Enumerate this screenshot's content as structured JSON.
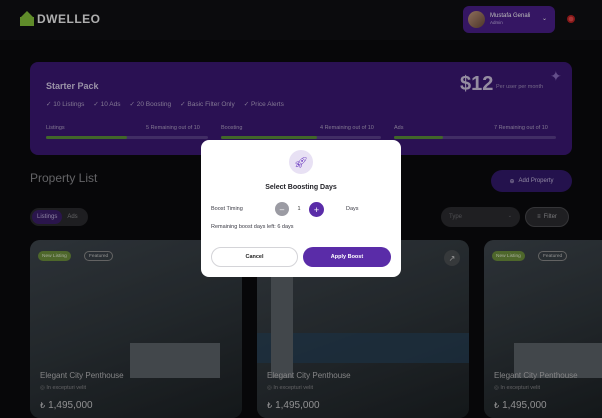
{
  "header": {
    "logo_text": "DWELLEO",
    "user_name": "Mustafa Genali",
    "user_role": "Admin"
  },
  "starter_pack": {
    "title": "Starter Pack",
    "features": [
      "10 Listings",
      "10 Ads",
      "20 Boosting",
      "Basic Filter Only",
      "Price Alerts"
    ],
    "price": "$12",
    "price_note": "Per user per month",
    "progress": [
      {
        "label": "Listings",
        "status": "5 Remaining out of 10",
        "fraction": 0.5
      },
      {
        "label": "Boosting",
        "status": "4 Remaining out of 10",
        "fraction": 0.6
      },
      {
        "label": "Ads",
        "status": "7 Remaining out of 10",
        "fraction": 0.3
      }
    ]
  },
  "property_list": {
    "title": "Property List",
    "add_label": "Add Property",
    "toggle_on": "Listings",
    "toggle_off": "Ads",
    "type_placeholder": "Type",
    "filter_label": "Filter",
    "cards": [
      {
        "badge_new": "New Listing",
        "badge_featured": "Featured",
        "title": "Elegant City Penthouse",
        "location": "In excepturi velit",
        "currency": "₺",
        "price": "1,495,000"
      },
      {
        "badge_new": "New Listing",
        "badge_featured": "Featured",
        "title": "Elegant City Penthouse",
        "location": "In excepturi velit",
        "currency": "₺",
        "price": "1,495,000"
      },
      {
        "badge_new": "New Listing",
        "badge_featured": "Featured",
        "title": "Elegant City Penthouse",
        "location": "In excepturi velit",
        "currency": "₺",
        "price": "1,495,000"
      }
    ]
  },
  "modal": {
    "title": "Select Boosting Days",
    "timing_label": "Boost Timing",
    "count": "1",
    "days_label": "Days",
    "remaining_text": "Remaining boost days left: 6 days",
    "cancel_label": "Cancel",
    "apply_label": "Apply Boost"
  },
  "colors": {
    "accent": "#5a2ca8",
    "brand_green": "#86c33b"
  }
}
